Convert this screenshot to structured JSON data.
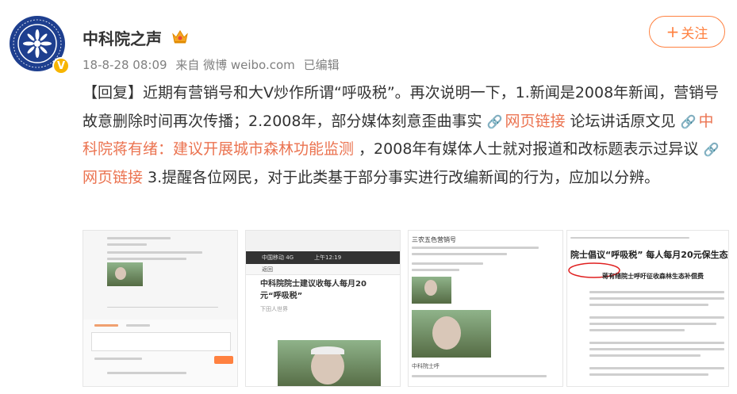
{
  "user": {
    "name": "中科院之声",
    "verified_badge": "V"
  },
  "meta": {
    "datetime": "18-8-28 08:09",
    "source": "来自 微博 weibo.com",
    "edited": "已编辑"
  },
  "follow_button": {
    "plus": "+",
    "label": "关注"
  },
  "post": {
    "p1": "【回复】近期有营销号和大V炒作所谓“呼吸税”。再次说明一下，1.新闻是2008年新闻，营销号故意删除时间再次传播；2.2008年，部分媒体刻意歪曲事实 ",
    "link1": "网页链接",
    "p2": " 论坛讲话原文见 ",
    "link2": "中科院蒋有绪：建议开展城市森林功能监测",
    "p3": " ，2008年有媒体人士就对报道和改标题表示过异议 ",
    "link3": "网页链接",
    "p4": " 3.提醒各位网民，对于此类基于部分事实进行改编新闻的行为，应加以分辨。"
  },
  "thumbnails": {
    "t2": {
      "status_bar": "中国移动 4G",
      "time": "上午12:19",
      "back": "返回",
      "headline": "中科院院士建议收每人每月20元“呼吸税”",
      "byline": "下田人世界"
    },
    "t3": {
      "account": "三农五色营销号",
      "caption": "中科院士呼"
    },
    "t4": {
      "headline": "院士倡议“呼吸税”  每人每月20元保生态",
      "sub": "蒋有绪院士呼吁征收森林生态补偿费"
    }
  },
  "colors": {
    "accent": "#ff8140",
    "link": "#eb7350",
    "meta": "#808080",
    "text": "#333333",
    "badge": "#f7b500",
    "avatar_bg": "#1e3f8f"
  },
  "icons": {
    "avatar": "cas-logo-icon",
    "crown": "crown-member-icon",
    "verified": "verified-badge-icon",
    "link": "chain-link-icon"
  }
}
